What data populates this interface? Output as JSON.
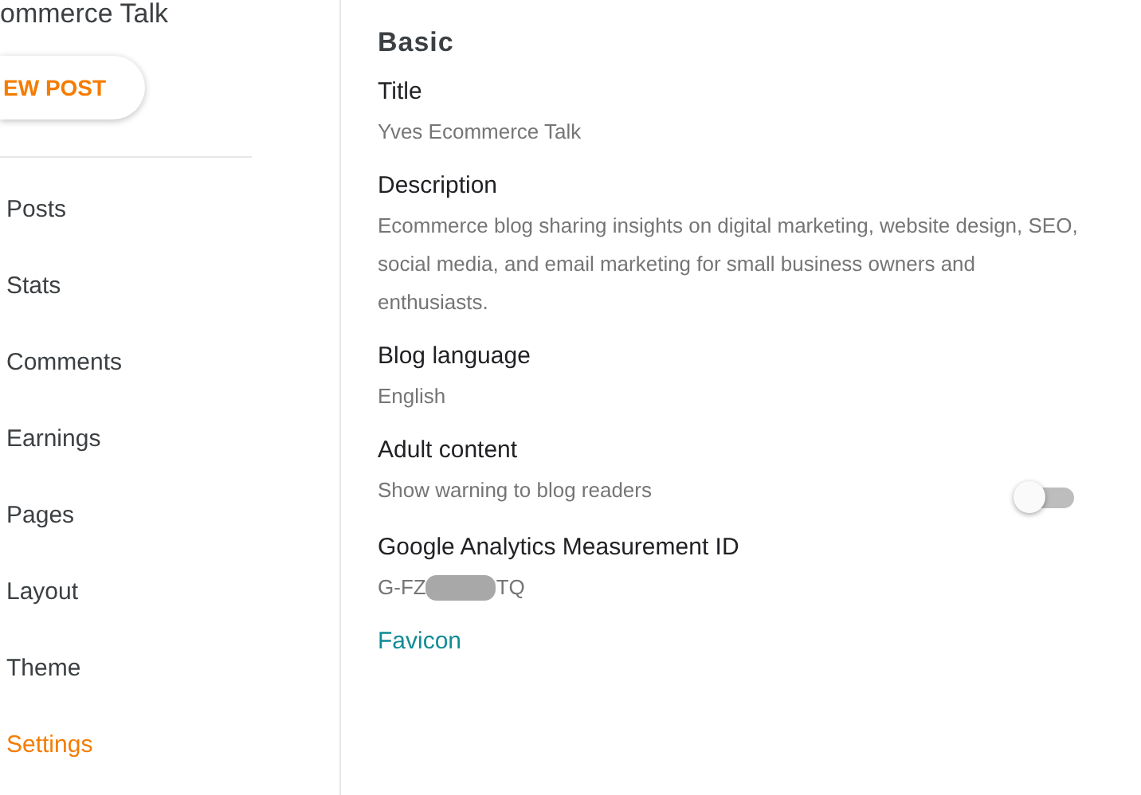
{
  "sidebar": {
    "blog_title": "ommerce Talk",
    "new_post_button": "EW POST",
    "items": [
      {
        "label": "Posts",
        "selected": false
      },
      {
        "label": "Stats",
        "selected": false
      },
      {
        "label": "Comments",
        "selected": false
      },
      {
        "label": "Earnings",
        "selected": false
      },
      {
        "label": "Pages",
        "selected": false
      },
      {
        "label": "Layout",
        "selected": false
      },
      {
        "label": "Theme",
        "selected": false
      },
      {
        "label": "Settings",
        "selected": true
      }
    ]
  },
  "main": {
    "heading": "Basic",
    "settings": [
      {
        "kind": "text",
        "label": "Title",
        "value": "Yves Ecommerce Talk"
      },
      {
        "kind": "text",
        "label": "Description",
        "value": "Ecommerce blog sharing insights on digital marketing, website design, SEO, social media, and email marketing for small business owners and enthusiasts."
      },
      {
        "kind": "text",
        "label": "Blog language",
        "value": "English"
      },
      {
        "kind": "toggle",
        "label": "Adult content",
        "value": "Show warning to blog readers",
        "on": false
      },
      {
        "kind": "redacted",
        "label": "Google Analytics Measurement ID",
        "value_start": "G-FZ",
        "value_end": "TQ"
      },
      {
        "kind": "link",
        "label": "Favicon"
      }
    ]
  }
}
